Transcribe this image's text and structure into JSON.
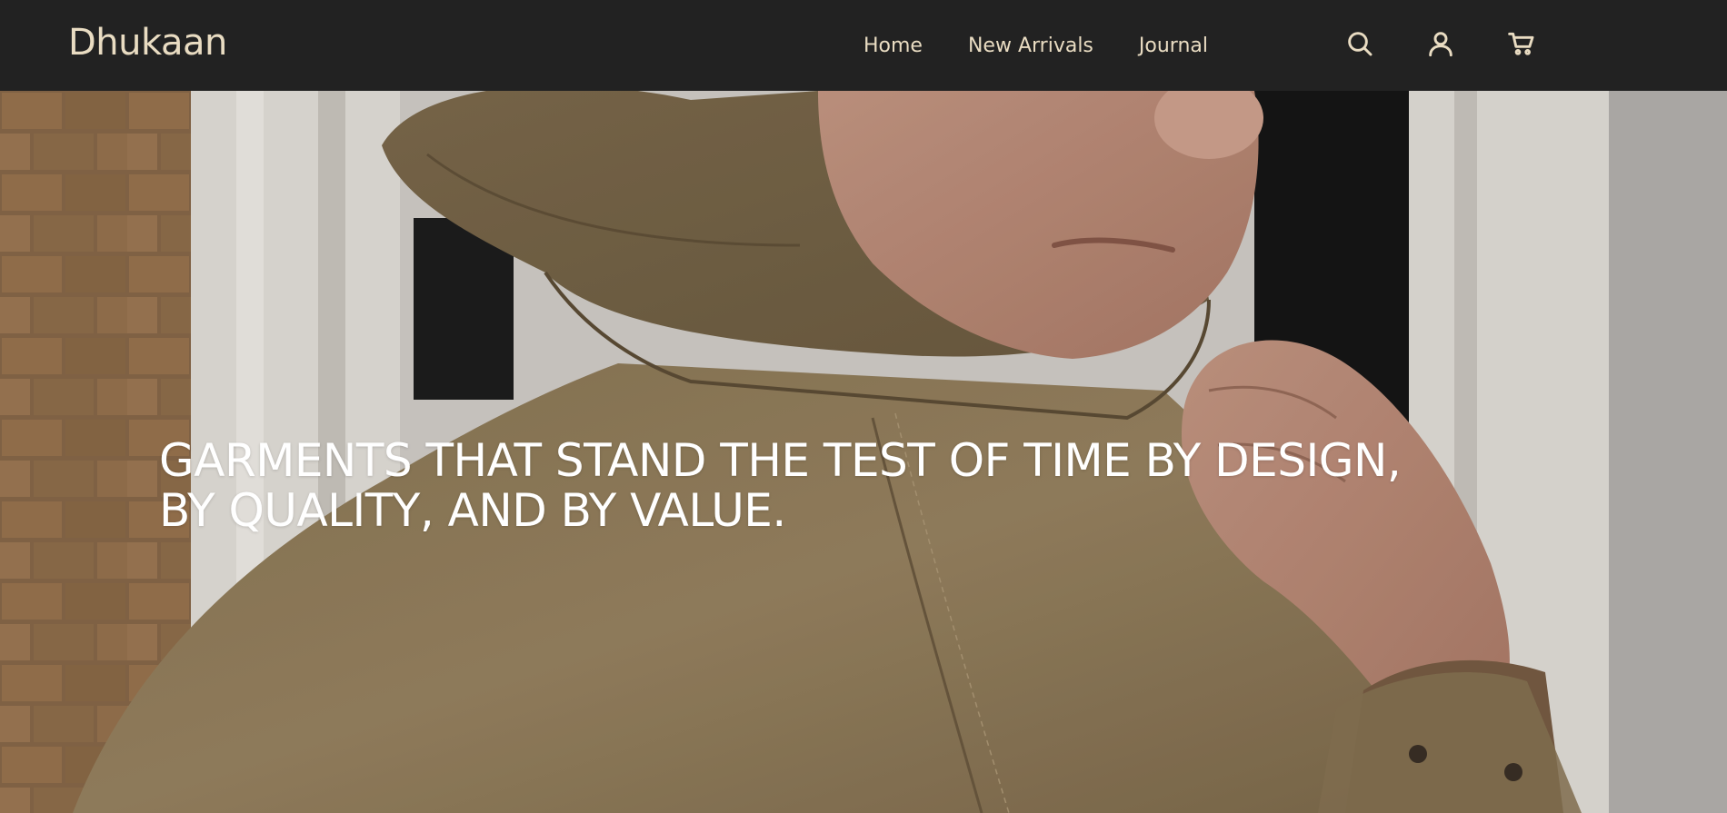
{
  "brand": {
    "name": "Dhukaan",
    "color": "#e9dcc2",
    "header_bg": "#222222"
  },
  "nav": {
    "items": [
      {
        "label": "Home"
      },
      {
        "label": "New Arrivals"
      },
      {
        "label": "Journal"
      }
    ]
  },
  "header_icons": [
    {
      "name": "search-icon"
    },
    {
      "name": "account-icon"
    },
    {
      "name": "cart-icon"
    }
  ],
  "hero": {
    "headline_line1": "GARMENTS THAT STAND THE TEST OF TIME BY DESIGN,",
    "headline_line2": "BY QUALITY, AND BY VALUE."
  }
}
